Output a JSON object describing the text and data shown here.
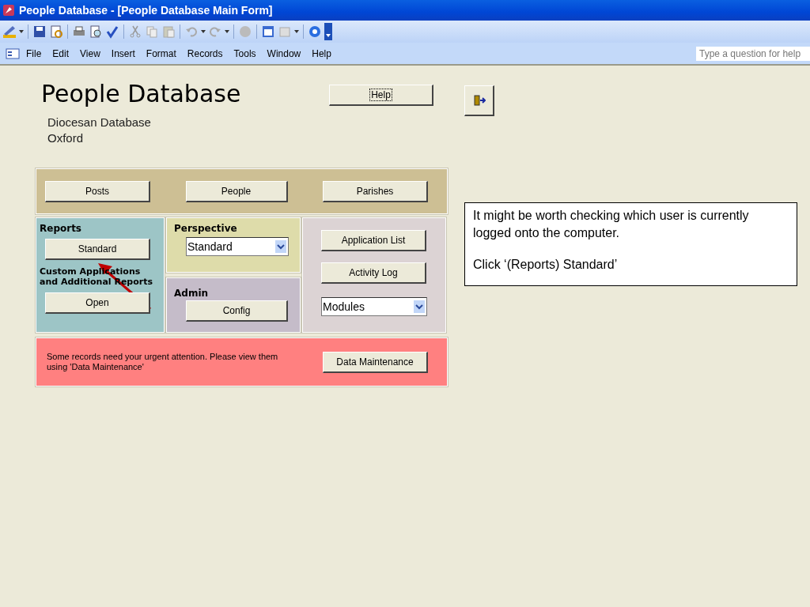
{
  "window": {
    "title": "People Database - [People Database Main Form]"
  },
  "menu_bar": {
    "items": [
      "File",
      "Edit",
      "View",
      "Insert",
      "Format",
      "Records",
      "Tools",
      "Window",
      "Help"
    ],
    "help_search": {
      "placeholder": "Type a question for help"
    }
  },
  "form": {
    "title": "People Database",
    "subtitle_lines": [
      "Diocesan Database",
      "Oxford"
    ],
    "help_button": {
      "label": "Help",
      "focused": true
    },
    "main_buttons": [
      "Posts",
      "People",
      "Parishes"
    ],
    "reports": {
      "heading": "Reports",
      "button": "Standard",
      "custom_heading_lines": [
        "Custom Applications",
        "and Additional Reports"
      ],
      "custom_button": "Open"
    },
    "perspective": {
      "heading": "Perspective",
      "value": "Standard"
    },
    "admin": {
      "heading": "Admin",
      "button": "Config"
    },
    "tools": {
      "buttons": [
        "Application List",
        "Activity Log"
      ],
      "modules_value": "Modules"
    },
    "alert": {
      "message": "Some records need your urgent attention. Please view them using 'Data Maintenance'",
      "button": "Data Maintenance"
    }
  },
  "callout": {
    "lines": [
      "It might be worth checking which user is currently logged onto the computer.",
      "Click ‘(Reports) Standard’"
    ]
  }
}
